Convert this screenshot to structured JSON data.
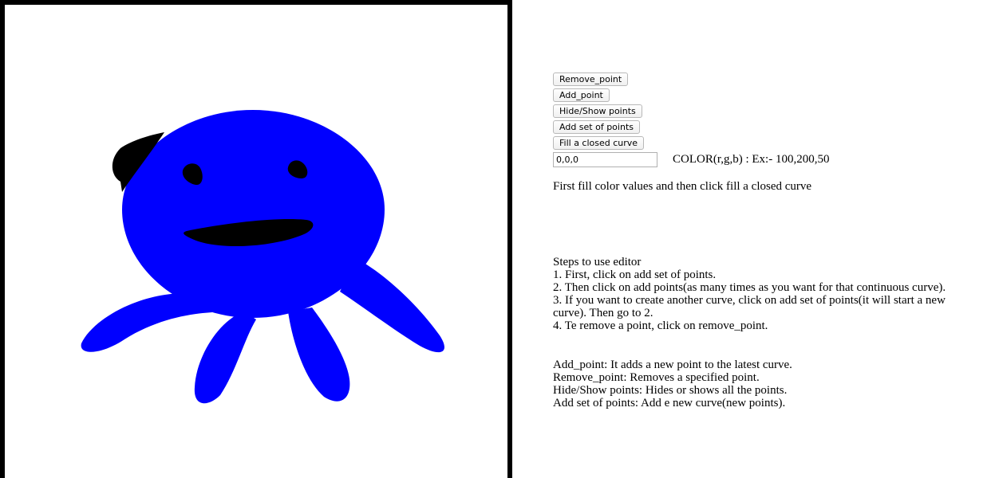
{
  "toolbar": {
    "remove_point": "Remove_point",
    "add_point": "Add_point",
    "hide_show": "Hide/Show points",
    "add_set": "Add set of points",
    "fill_curve": "Fill a closed curve"
  },
  "color_input": {
    "value": "0,0,0",
    "label": "COLOR(r,g,b) : Ex:- 100,200,50"
  },
  "fill_instruction": "First fill color values and then click fill a closed curve",
  "steps": {
    "title": "Steps to use editor",
    "items": [
      "1. First, click on add set of points.",
      "2. Then click on add points(as many times as you want for that continuous curve).",
      "3. If you want to create another curve, click on add set of points(it will start a new",
      "curve). Then go to 2.",
      "4. Te remove a point, click on remove_point."
    ]
  },
  "help": [
    "Add_point: It adds a new point to the latest curve.",
    "Remove_point: Removes a specified point.",
    "Hide/Show points: Hides or shows all the points.",
    "Add set of points: Add e new curve(new points)."
  ],
  "colors": {
    "body": "#0000ff",
    "features": "#000000",
    "frame": "#000000"
  }
}
